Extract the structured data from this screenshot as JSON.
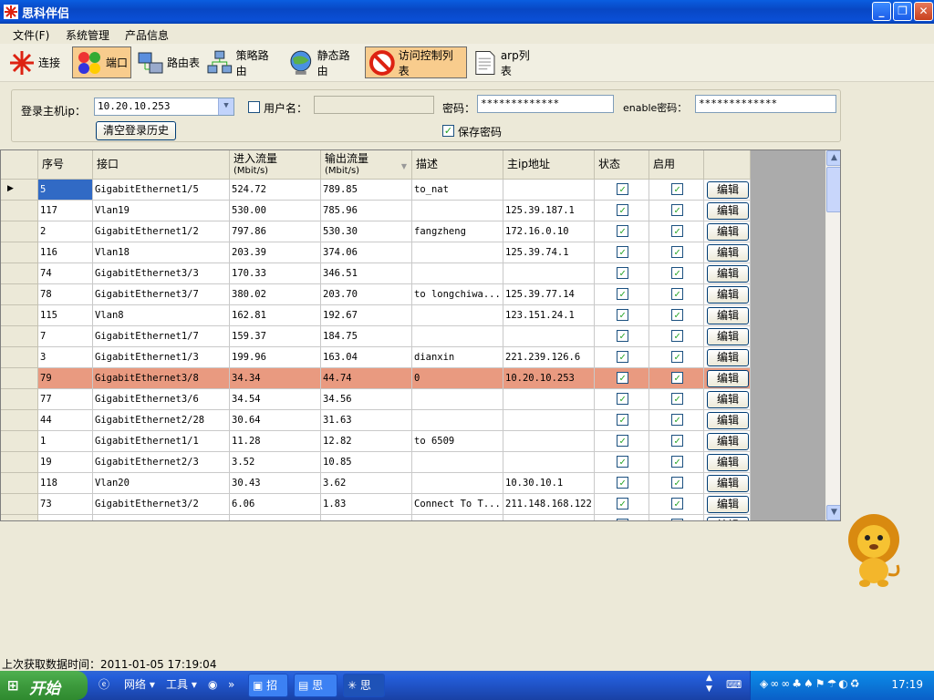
{
  "window": {
    "title": "思科伴侣"
  },
  "menu": [
    "文件(F)",
    "系统管理",
    "产品信息"
  ],
  "toolbar": [
    {
      "label": "连接",
      "icon": "cisco-connect-icon",
      "active": false
    },
    {
      "label": "端口",
      "icon": "port-icon",
      "active": true
    },
    {
      "label": "路由表",
      "icon": "routing-table-icon",
      "active": false
    },
    {
      "label": "策略路由",
      "icon": "policy-route-icon",
      "active": false
    },
    {
      "label": "静态路由",
      "icon": "static-route-icon",
      "active": false
    },
    {
      "label": "访问控制列表",
      "icon": "acl-icon",
      "active": true
    },
    {
      "label": "arp列表",
      "icon": "arp-list-icon",
      "active": false
    }
  ],
  "login": {
    "host_label": "登录主机ip：",
    "host_value": "10.20.10.253",
    "clear_history": "清空登录历史",
    "username_label": "用户名：",
    "password_label": "密码：",
    "password_value": "*************",
    "enable_label": "enable密码：",
    "enable_value": "*************",
    "save_password": "保存密码"
  },
  "grid": {
    "columns": [
      "序号",
      "接口",
      "进入流量",
      "(Mbit/s)",
      "输出流量",
      "(Mbit/s)",
      "描述",
      "主ip地址",
      "状态",
      "启用"
    ],
    "edit_label": "编辑",
    "rows": [
      {
        "id": "5",
        "iface": "GigabitEthernet1/5",
        "in": "524.72",
        "out": "789.85",
        "desc": "to_nat",
        "ip": ""
      },
      {
        "id": "117",
        "iface": "Vlan19",
        "in": "530.00",
        "out": "785.96",
        "desc": "",
        "ip": "125.39.187.1"
      },
      {
        "id": "2",
        "iface": "GigabitEthernet1/2",
        "in": "797.86",
        "out": "530.30",
        "desc": "fangzheng",
        "ip": "172.16.0.10"
      },
      {
        "id": "116",
        "iface": "Vlan18",
        "in": "203.39",
        "out": "374.06",
        "desc": "",
        "ip": "125.39.74.1"
      },
      {
        "id": "74",
        "iface": "GigabitEthernet3/3",
        "in": "170.33",
        "out": "346.51",
        "desc": "",
        "ip": ""
      },
      {
        "id": "78",
        "iface": "GigabitEthernet3/7",
        "in": "380.02",
        "out": "203.70",
        "desc": "to longchiwa...",
        "ip": "125.39.77.14"
      },
      {
        "id": "115",
        "iface": "Vlan8",
        "in": "162.81",
        "out": "192.67",
        "desc": "",
        "ip": "123.151.24.1"
      },
      {
        "id": "7",
        "iface": "GigabitEthernet1/7",
        "in": "159.37",
        "out": "184.75",
        "desc": "",
        "ip": ""
      },
      {
        "id": "3",
        "iface": "GigabitEthernet1/3",
        "in": "199.96",
        "out": "163.04",
        "desc": "dianxin",
        "ip": "221.239.126.6"
      },
      {
        "id": "79",
        "iface": "GigabitEthernet3/8",
        "in": "34.34",
        "out": "44.74",
        "desc": "0",
        "ip": "10.20.10.253"
      },
      {
        "id": "77",
        "iface": "GigabitEthernet3/6",
        "in": "34.54",
        "out": "34.56",
        "desc": "",
        "ip": ""
      },
      {
        "id": "44",
        "iface": "GigabitEthernet2/28",
        "in": "30.64",
        "out": "31.63",
        "desc": "",
        "ip": ""
      },
      {
        "id": "1",
        "iface": "GigabitEthernet1/1",
        "in": "11.28",
        "out": "12.82",
        "desc": "to 6509",
        "ip": ""
      },
      {
        "id": "19",
        "iface": "GigabitEthernet2/3",
        "in": "3.52",
        "out": "10.85",
        "desc": "",
        "ip": ""
      },
      {
        "id": "118",
        "iface": "Vlan20",
        "in": "30.43",
        "out": "3.62",
        "desc": "",
        "ip": "10.30.10.1"
      },
      {
        "id": "73",
        "iface": "GigabitEthernet3/2",
        "in": "6.06",
        "out": "1.83",
        "desc": "Connect To T...",
        "ip": "211.148.168.122"
      }
    ]
  },
  "status": {
    "text": "上次获取数据时间：2011-01-05 17:19:04"
  },
  "taskbar": {
    "start": "开始",
    "network": "网络",
    "tools": "工具",
    "tasks": [
      "招",
      "思",
      "思"
    ],
    "clock": "17:19"
  }
}
